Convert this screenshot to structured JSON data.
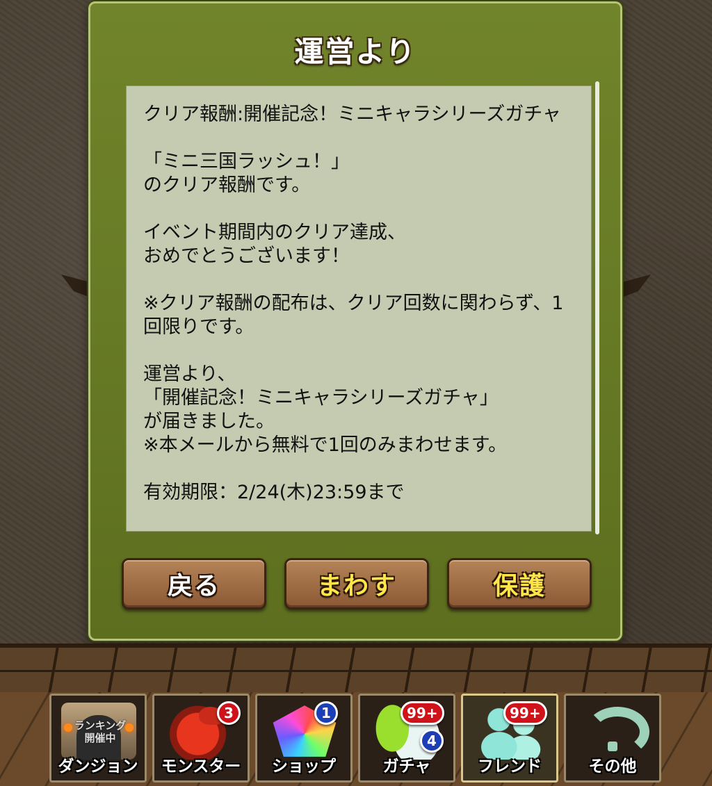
{
  "dialog": {
    "title": "運営より",
    "message": "クリア報酬:開催記念！ミニキャラシリーズガチャ\n\n「ミニ三国ラッシュ！」\nのクリア報酬です。\n\nイベント期間内のクリア達成、\nおめでとうございます！\n\n※クリア報酬の配布は、クリア回数に関わらず、1回限りです。\n\n運営より、\n「開催記念！ミニキャラシリーズガチャ」\nが届きました。\n※本メールから無料で1回のみまわせます。\n\n有効期限：2/24(木)23:59まで",
    "buttons": {
      "back": "戻る",
      "spin": "まわす",
      "protect": "保護"
    }
  },
  "nav": {
    "items": [
      {
        "label": "ダンジョン",
        "overlay": "ランキング\n開催中",
        "icon": "dungeon-gate-icon"
      },
      {
        "label": "モンスター",
        "badge": "3",
        "icon": "dragon-icon"
      },
      {
        "label": "ショップ",
        "badge": "1",
        "icon": "rainbow-gem-icon"
      },
      {
        "label": "ガチャ",
        "badge": "99+",
        "badge2": "4",
        "icon": "egg-icon"
      },
      {
        "label": "フレンド",
        "badge": "99+",
        "icon": "friends-icon"
      },
      {
        "label": "その他",
        "icon": "question-icon"
      }
    ]
  },
  "colors": {
    "dialog_green": "#687a25",
    "panel": "#c4cbb1",
    "button_brown": "#a0704a",
    "badge_red": "#d0121b",
    "badge_blue": "#1c3fb8",
    "accent_yellow": "#ffe54a"
  }
}
